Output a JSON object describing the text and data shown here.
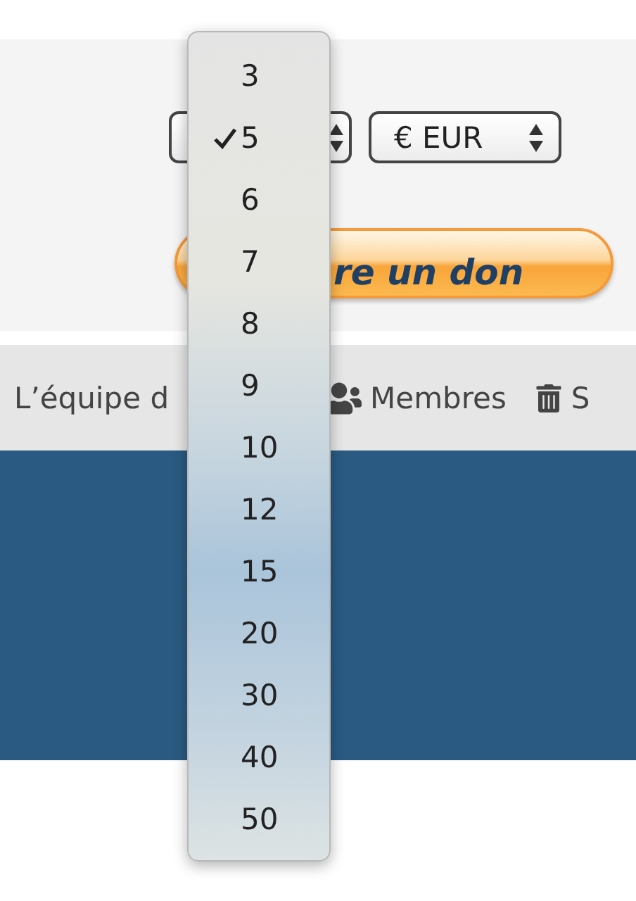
{
  "currency_select": {
    "value": "€ EUR"
  },
  "donate_button": {
    "label": "re un don"
  },
  "nav": [
    {
      "label": "L’équipe d"
    },
    {
      "label": "Membres"
    },
    {
      "label": "S"
    }
  ],
  "dropdown": {
    "options": [
      {
        "label": "3",
        "selected": false
      },
      {
        "label": "5",
        "selected": true
      },
      {
        "label": "6",
        "selected": false
      },
      {
        "label": "7",
        "selected": false
      },
      {
        "label": "8",
        "selected": false
      },
      {
        "label": "9",
        "selected": false
      },
      {
        "label": "10",
        "selected": false
      },
      {
        "label": "12",
        "selected": false
      },
      {
        "label": "15",
        "selected": false
      },
      {
        "label": "20",
        "selected": false
      },
      {
        "label": "30",
        "selected": false
      },
      {
        "label": "40",
        "selected": false
      },
      {
        "label": "50",
        "selected": false
      }
    ]
  }
}
